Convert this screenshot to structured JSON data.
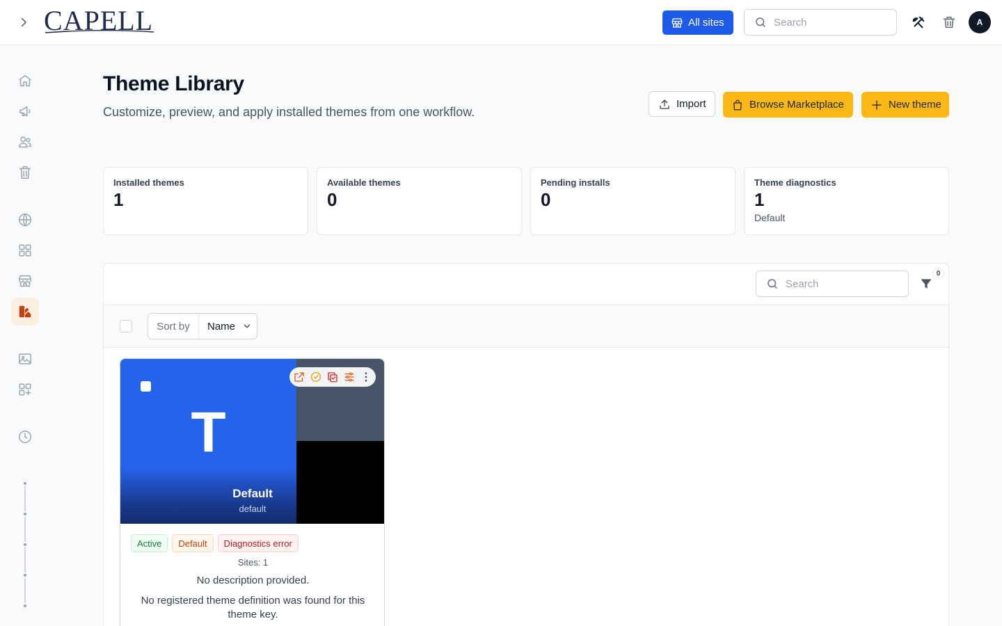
{
  "topbar": {
    "logo_text": "CAPELL",
    "all_sites_label": "All sites",
    "search_placeholder": "Search",
    "avatar_initial": "A"
  },
  "sidebar": {
    "items": [
      {
        "icon": "home-icon"
      },
      {
        "icon": "megaphone-icon"
      },
      {
        "icon": "users-icon"
      },
      {
        "icon": "trash-icon"
      },
      {
        "icon": "globe-icon"
      },
      {
        "icon": "grid-icon"
      },
      {
        "icon": "store-icon"
      },
      {
        "icon": "theme-icon",
        "active": true
      },
      {
        "icon": "image-icon"
      },
      {
        "icon": "add-grid-icon"
      },
      {
        "icon": "clock-icon"
      }
    ]
  },
  "header": {
    "title": "Theme Library",
    "subtitle": "Customize, preview, and apply installed themes from one workflow.",
    "import_label": "Import",
    "marketplace_label": "Browse Marketplace",
    "new_theme_label": "New theme"
  },
  "stats": [
    {
      "label": "Installed themes",
      "value": "1",
      "sub": ""
    },
    {
      "label": "Available themes",
      "value": "0",
      "sub": ""
    },
    {
      "label": "Pending installs",
      "value": "0",
      "sub": ""
    },
    {
      "label": "Theme diagnostics",
      "value": "1",
      "sub": "Default"
    }
  ],
  "list": {
    "search_placeholder": "Search",
    "filter_count": "0",
    "sort_label": "Sort by",
    "sort_value": "Name"
  },
  "theme_card": {
    "letter": "T",
    "name": "Default",
    "key": "default",
    "badges": [
      "Active",
      "Default",
      "Diagnostics error"
    ],
    "sites": "Sites: 1",
    "description": "No description provided.",
    "warning": "No registered theme definition was found for this theme key.",
    "colors": {
      "primary": "#2563eb",
      "secondary": "#475569",
      "tertiary": "#000000"
    }
  },
  "colors": {
    "brand_blue": "#1d5be8",
    "accent_yellow": "#fbb714",
    "active_orange": "#c2410c"
  }
}
